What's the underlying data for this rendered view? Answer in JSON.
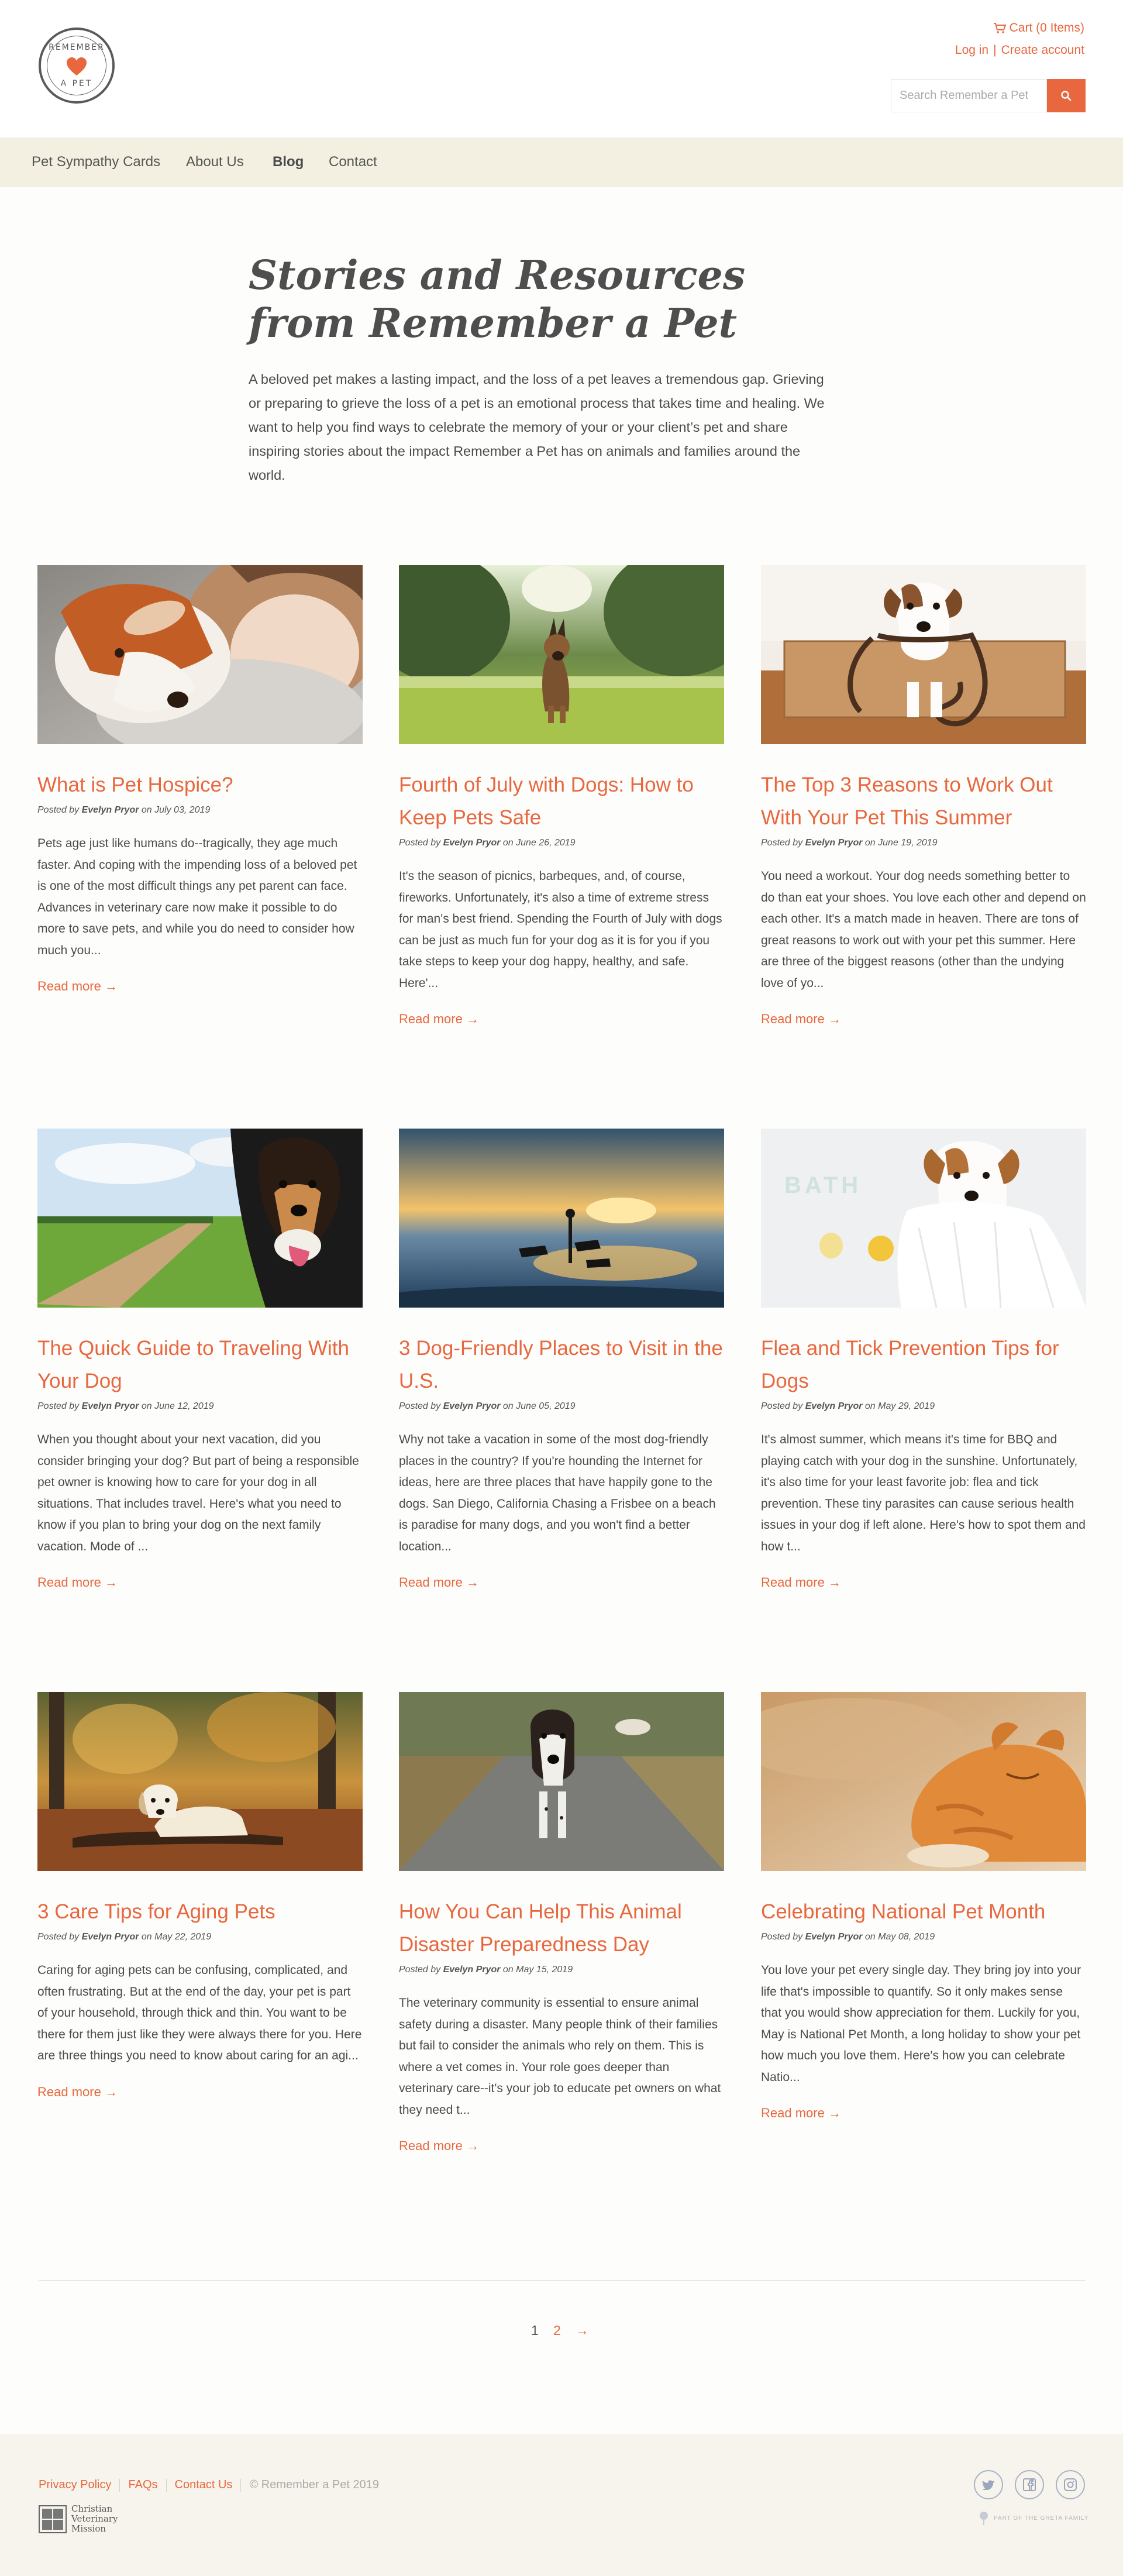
{
  "brand": {
    "logo_text_top": "REMEMBER",
    "logo_text_bottom": "A PET",
    "accent_color": "#e8673e"
  },
  "header": {
    "cart_label": "Cart (0 Items)",
    "login_label": "Log in",
    "separator": "|",
    "create_account_label": "Create account",
    "search_placeholder": "Search Remember a Pet"
  },
  "nav": {
    "items": [
      {
        "label": "Pet Sympathy Cards"
      },
      {
        "label": "About Us"
      },
      {
        "label": "Blog"
      },
      {
        "label": "Contact"
      }
    ],
    "active": "Blog"
  },
  "intro": {
    "title": "Stories and Resources from Remember a Pet",
    "body": "A beloved pet makes a lasting impact, and the loss of a pet leaves a tremendous gap. Grieving or preparing to grieve the loss of a pet is an emotional process that takes time and healing. We want to help you find ways to celebrate the memory of your or your client’s pet and share inspiring stories about the impact Remember a Pet has on animals and families around the world."
  },
  "posts": [
    {
      "title": "What is Pet Hospice?",
      "posted_by": "Posted by",
      "author": "Evelyn Pryor",
      "on": "on",
      "date": "July 03, 2019",
      "excerpt": "Pets age just like humans do--tragically, they age much faster. And coping with the impending loss of a beloved pet is one of the most difficult things any pet parent can face. Advances in veterinary care now make it possible to do more to save pets, and while you do need to consider how much you...",
      "read_more": "Read more →",
      "image": "dog-and-girl-photo"
    },
    {
      "title": "Fourth of July with Dogs: How to Keep Pets Safe",
      "posted_by": "Posted by",
      "author": "Evelyn Pryor",
      "on": "on",
      "date": "June 26, 2019",
      "excerpt": "It's the season of picnics, barbeques, and, of course, fireworks. Unfortunately, it's also a time of extreme stress for man's best friend. Spending the Fourth of July with dogs can be just as much fun for your dog as it is for you if you take steps to keep your dog happy, healthy, and safe. Here'...",
      "read_more": "Read more →",
      "image": "german-shepherd-in-park-photo"
    },
    {
      "title": "The Top 3 Reasons to Work Out With Your Pet This Summer",
      "posted_by": "Posted by",
      "author": "Evelyn Pryor",
      "on": "on",
      "date": "June 19, 2019",
      "excerpt": "You need a workout. Your dog needs something better to do than eat your shoes. You love each other and depend on each other. It's a match made in heaven. There are tons of great reasons to work out with your pet this summer. Here are three of the biggest reasons (other than the undying love of yo...",
      "read_more": "Read more →",
      "image": "terrier-with-leash-photo"
    },
    {
      "title": "The Quick Guide to Traveling With Your Dog",
      "posted_by": "Posted by",
      "author": "Evelyn Pryor",
      "on": "on",
      "date": "June 12, 2019",
      "excerpt": "When you thought about your next vacation, did you consider bringing your dog?  But part of being a responsible pet owner is knowing how to care for your dog in all situations. That includes travel. Here's what you need to know if you plan to bring your dog on the next family vacation.   Mode of ...",
      "read_more": "Read more →",
      "image": "dog-in-car-window-photo"
    },
    {
      "title": "3 Dog-Friendly Places to Visit in the U.S.",
      "posted_by": "Posted by",
      "author": "Evelyn Pryor",
      "on": "on",
      "date": "June 05, 2019",
      "excerpt": "Why not take a vacation in some of the most dog-friendly places in the country? If you're hounding the Internet for ideas, here are three places that have happily gone to the dogs.   San Diego, California Chasing a Frisbee on a beach is paradise for many dogs, and you won't find a better location...",
      "read_more": "Read more →",
      "image": "beach-sunset-with-dogs-photo"
    },
    {
      "title": "Flea and Tick Prevention Tips for Dogs",
      "posted_by": "Posted by",
      "author": "Evelyn Pryor",
      "on": "on",
      "date": "May 29, 2019",
      "excerpt": "It's almost summer, which means it's time for BBQ and playing catch with your dog in the sunshine. Unfortunately, it's also time for your least favorite job: flea and tick prevention. These tiny parasites can cause serious health issues in your dog if left alone. Here's how to spot them and how t...",
      "read_more": "Read more →",
      "image": "dog-in-towel-bath-photo",
      "image_text": "BATH"
    },
    {
      "title": "3 Care Tips for Aging Pets",
      "posted_by": "Posted by",
      "author": "Evelyn Pryor",
      "on": "on",
      "date": "May 22, 2019",
      "excerpt": "Caring for aging pets can be confusing, complicated, and often frustrating. But at the end of the day, your pet is part of your household, through thick and thin. You want to be there for them just like they were always there for you. Here are three things you need to know about caring for an agi...",
      "read_more": "Read more →",
      "image": "old-dog-in-autumn-leaves-photo"
    },
    {
      "title": "How You Can Help This Animal Disaster Preparedness Day",
      "posted_by": "Posted by",
      "author": "Evelyn Pryor",
      "on": "on",
      "date": "May 15, 2019",
      "excerpt": "The veterinary community is essential to ensure animal safety during a disaster. Many people think of their families but fail to consider the animals who rely on them. This is where a vet comes in. Your role goes deeper than veterinary care--it's your job to educate pet owners on what they need t...",
      "read_more": "Read more →",
      "image": "dogs-on-road-photo"
    },
    {
      "title": "Celebrating National Pet Month",
      "posted_by": "Posted by",
      "author": "Evelyn Pryor",
      "on": "on",
      "date": "May 08, 2019",
      "excerpt": "You love your pet every single day. They bring joy into your life that's impossible to quantify. So it only makes sense that you would show appreciation for them. Luckily for you, May is National Pet Month, a long holiday to show your pet how much you love them. Here's how you can celebrate Natio...",
      "read_more": "Read more →",
      "image": "sleeping-orange-cat-photo"
    }
  ],
  "pagination": {
    "current": "1",
    "next_page": "2",
    "next_arrow": "→"
  },
  "footer": {
    "links": [
      {
        "label": "Privacy Policy"
      },
      {
        "label": "FAQs"
      },
      {
        "label": "Contact Us"
      }
    ],
    "copyright": "© Remember a Pet 2019",
    "cvm_lines": [
      "Christian",
      "Veterinary",
      "Mission"
    ],
    "greta_label": "PART OF THE GRETA FAMILY",
    "social_icons": [
      "twitter-icon",
      "facebook-icon",
      "instagram-icon"
    ]
  }
}
